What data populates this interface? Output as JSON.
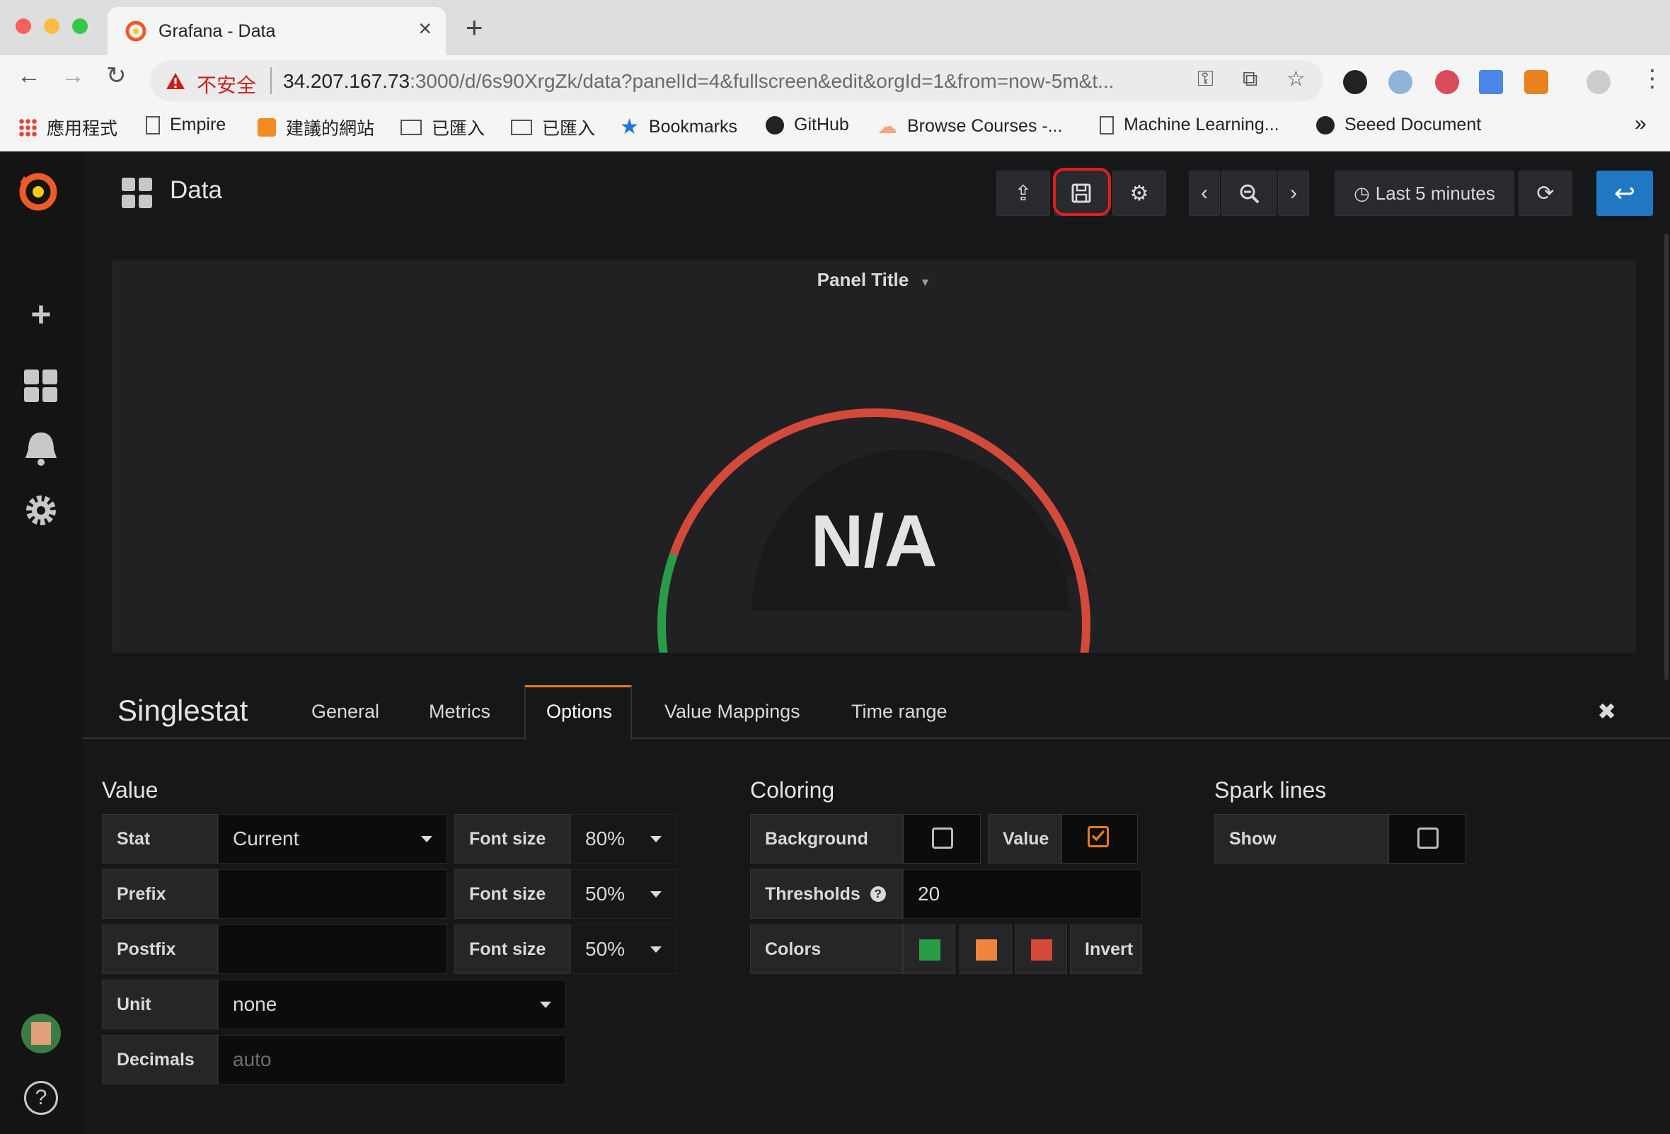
{
  "browser": {
    "tab_title": "Grafana - Data",
    "tab_close": "×",
    "new_tab": "+",
    "security_warning": "不安全",
    "url_host": "34.207.167.73",
    "url_rest": ":3000/d/6s90XrgZk/data?panelId=4&fullscreen&edit&orgId=1&from=now-5m&t...",
    "bookmarks": [
      {
        "label": "應用程式",
        "icon": "apps-grid-icon"
      },
      {
        "label": "Empire",
        "icon": "page-icon"
      },
      {
        "label": "建議的網站",
        "icon": "bulb-icon"
      },
      {
        "label": "已匯入",
        "icon": "folder-icon"
      },
      {
        "label": "已匯入",
        "icon": "folder-icon"
      },
      {
        "label": "Bookmarks",
        "icon": "star-icon"
      },
      {
        "label": "GitHub",
        "icon": "github-icon"
      },
      {
        "label": "Browse Courses -...",
        "icon": "cloud-icon"
      },
      {
        "label": "Machine Learning...",
        "icon": "page-icon"
      },
      {
        "label": "Seeed Document",
        "icon": "github-icon"
      }
    ],
    "bookmarks_overflow": "»"
  },
  "grafana": {
    "dashboard_title": "Data",
    "time_range_label": "Last 5 minutes",
    "panel": {
      "title": "Panel Title",
      "value": "N/A",
      "gauge_colors": {
        "ok": "#299c46",
        "warn": "#d44a3a",
        "track": "#2a2a2c"
      }
    },
    "editor": {
      "title": "Singlestat",
      "tabs": [
        "General",
        "Metrics",
        "Options",
        "Value Mappings",
        "Time range"
      ],
      "active_tab": "Options",
      "close": "✖",
      "value_section": {
        "heading": "Value",
        "stat_label": "Stat",
        "stat_value": "Current",
        "prefix_label": "Prefix",
        "prefix_value": "",
        "postfix_label": "Postfix",
        "postfix_value": "",
        "font_size_label": "Font size",
        "font_size_1": "80%",
        "font_size_2": "50%",
        "font_size_3": "50%",
        "unit_label": "Unit",
        "unit_value": "none",
        "decimals_label": "Decimals",
        "decimals_placeholder": "auto"
      },
      "coloring_section": {
        "heading": "Coloring",
        "background_label": "Background",
        "background_checked": false,
        "value_label": "Value",
        "value_checked": true,
        "thresholds_label": "Thresholds",
        "thresholds_help": "?",
        "thresholds_value": "20",
        "colors_label": "Colors",
        "colors": [
          "#299c46",
          "#ef843c",
          "#d44a3a"
        ],
        "invert_label": "Invert"
      },
      "spark_section": {
        "heading": "Spark lines",
        "show_label": "Show",
        "show_checked": false
      }
    }
  }
}
